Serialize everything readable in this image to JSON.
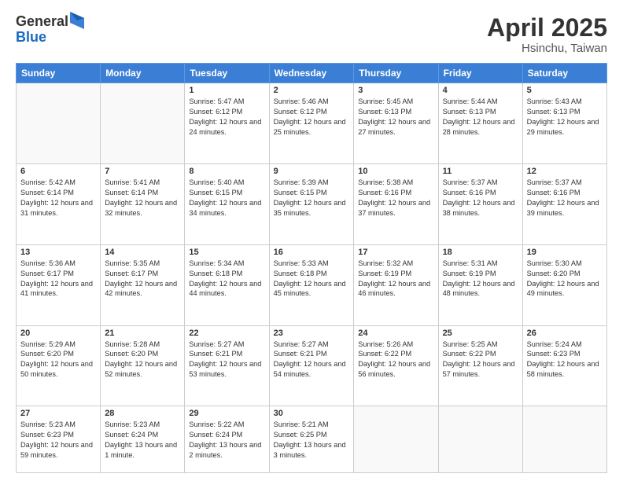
{
  "header": {
    "logo_general": "General",
    "logo_blue": "Blue",
    "title": "April 2025",
    "location": "Hsinchu, Taiwan"
  },
  "weekdays": [
    "Sunday",
    "Monday",
    "Tuesday",
    "Wednesday",
    "Thursday",
    "Friday",
    "Saturday"
  ],
  "weeks": [
    [
      {
        "day": "",
        "info": ""
      },
      {
        "day": "",
        "info": ""
      },
      {
        "day": "1",
        "info": "Sunrise: 5:47 AM\nSunset: 6:12 PM\nDaylight: 12 hours and 24 minutes."
      },
      {
        "day": "2",
        "info": "Sunrise: 5:46 AM\nSunset: 6:12 PM\nDaylight: 12 hours and 25 minutes."
      },
      {
        "day": "3",
        "info": "Sunrise: 5:45 AM\nSunset: 6:13 PM\nDaylight: 12 hours and 27 minutes."
      },
      {
        "day": "4",
        "info": "Sunrise: 5:44 AM\nSunset: 6:13 PM\nDaylight: 12 hours and 28 minutes."
      },
      {
        "day": "5",
        "info": "Sunrise: 5:43 AM\nSunset: 6:13 PM\nDaylight: 12 hours and 29 minutes."
      }
    ],
    [
      {
        "day": "6",
        "info": "Sunrise: 5:42 AM\nSunset: 6:14 PM\nDaylight: 12 hours and 31 minutes."
      },
      {
        "day": "7",
        "info": "Sunrise: 5:41 AM\nSunset: 6:14 PM\nDaylight: 12 hours and 32 minutes."
      },
      {
        "day": "8",
        "info": "Sunrise: 5:40 AM\nSunset: 6:15 PM\nDaylight: 12 hours and 34 minutes."
      },
      {
        "day": "9",
        "info": "Sunrise: 5:39 AM\nSunset: 6:15 PM\nDaylight: 12 hours and 35 minutes."
      },
      {
        "day": "10",
        "info": "Sunrise: 5:38 AM\nSunset: 6:16 PM\nDaylight: 12 hours and 37 minutes."
      },
      {
        "day": "11",
        "info": "Sunrise: 5:37 AM\nSunset: 6:16 PM\nDaylight: 12 hours and 38 minutes."
      },
      {
        "day": "12",
        "info": "Sunrise: 5:37 AM\nSunset: 6:16 PM\nDaylight: 12 hours and 39 minutes."
      }
    ],
    [
      {
        "day": "13",
        "info": "Sunrise: 5:36 AM\nSunset: 6:17 PM\nDaylight: 12 hours and 41 minutes."
      },
      {
        "day": "14",
        "info": "Sunrise: 5:35 AM\nSunset: 6:17 PM\nDaylight: 12 hours and 42 minutes."
      },
      {
        "day": "15",
        "info": "Sunrise: 5:34 AM\nSunset: 6:18 PM\nDaylight: 12 hours and 44 minutes."
      },
      {
        "day": "16",
        "info": "Sunrise: 5:33 AM\nSunset: 6:18 PM\nDaylight: 12 hours and 45 minutes."
      },
      {
        "day": "17",
        "info": "Sunrise: 5:32 AM\nSunset: 6:19 PM\nDaylight: 12 hours and 46 minutes."
      },
      {
        "day": "18",
        "info": "Sunrise: 5:31 AM\nSunset: 6:19 PM\nDaylight: 12 hours and 48 minutes."
      },
      {
        "day": "19",
        "info": "Sunrise: 5:30 AM\nSunset: 6:20 PM\nDaylight: 12 hours and 49 minutes."
      }
    ],
    [
      {
        "day": "20",
        "info": "Sunrise: 5:29 AM\nSunset: 6:20 PM\nDaylight: 12 hours and 50 minutes."
      },
      {
        "day": "21",
        "info": "Sunrise: 5:28 AM\nSunset: 6:20 PM\nDaylight: 12 hours and 52 minutes."
      },
      {
        "day": "22",
        "info": "Sunrise: 5:27 AM\nSunset: 6:21 PM\nDaylight: 12 hours and 53 minutes."
      },
      {
        "day": "23",
        "info": "Sunrise: 5:27 AM\nSunset: 6:21 PM\nDaylight: 12 hours and 54 minutes."
      },
      {
        "day": "24",
        "info": "Sunrise: 5:26 AM\nSunset: 6:22 PM\nDaylight: 12 hours and 56 minutes."
      },
      {
        "day": "25",
        "info": "Sunrise: 5:25 AM\nSunset: 6:22 PM\nDaylight: 12 hours and 57 minutes."
      },
      {
        "day": "26",
        "info": "Sunrise: 5:24 AM\nSunset: 6:23 PM\nDaylight: 12 hours and 58 minutes."
      }
    ],
    [
      {
        "day": "27",
        "info": "Sunrise: 5:23 AM\nSunset: 6:23 PM\nDaylight: 12 hours and 59 minutes."
      },
      {
        "day": "28",
        "info": "Sunrise: 5:23 AM\nSunset: 6:24 PM\nDaylight: 13 hours and 1 minute."
      },
      {
        "day": "29",
        "info": "Sunrise: 5:22 AM\nSunset: 6:24 PM\nDaylight: 13 hours and 2 minutes."
      },
      {
        "day": "30",
        "info": "Sunrise: 5:21 AM\nSunset: 6:25 PM\nDaylight: 13 hours and 3 minutes."
      },
      {
        "day": "",
        "info": ""
      },
      {
        "day": "",
        "info": ""
      },
      {
        "day": "",
        "info": ""
      }
    ]
  ]
}
